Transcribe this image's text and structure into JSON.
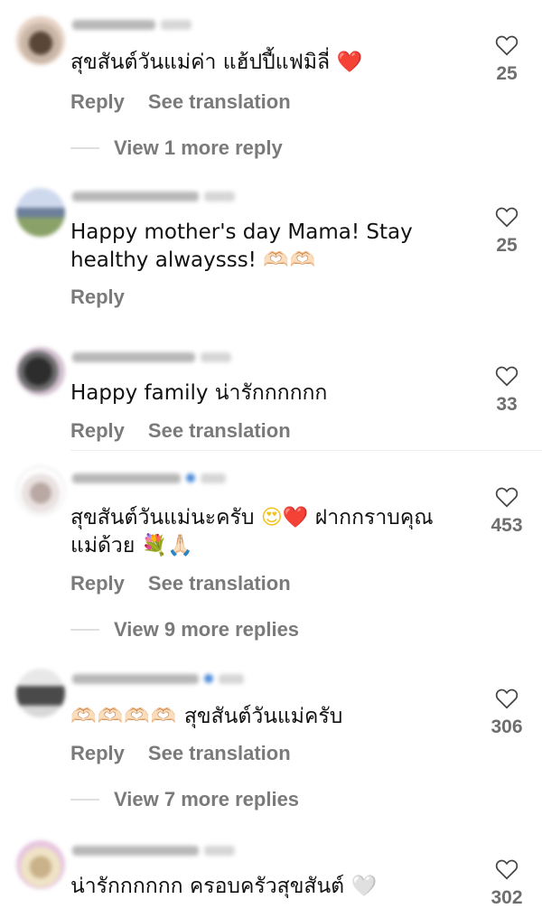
{
  "colors": {
    "action_grey": "#7a7a7a",
    "count_grey": "#6e6e6e",
    "verified_blue": "#4a8ad8",
    "heart_red": "#e3242b"
  },
  "icons": {
    "like": "heart-outline-icon"
  },
  "comments": [
    {
      "text": "สุขสันต์วันแม่ค่า แฮ้ปปี้แฟมิลี่ ",
      "emoji": "❤️",
      "actions": [
        "Reply",
        "See translation"
      ],
      "likes": "25",
      "more": "View 1 more reply"
    },
    {
      "text": "Happy mother's day Mama! Stay healthy alwaysss! ",
      "emoji": "🫶🏻🫶🏻",
      "actions": [
        "Reply"
      ],
      "likes": "25"
    },
    {
      "text": "Happy family น่ารักกกกกก",
      "actions": [
        "Reply",
        "See translation"
      ],
      "likes": "33"
    },
    {
      "text": "สุขสันต์วันแม่นะครับ ",
      "emoji": "😍❤️",
      "text2": " ฝากกราบคุณแม่ด้วย ",
      "emoji2": "💐🙏🏻",
      "actions": [
        "Reply",
        "See translation"
      ],
      "likes": "453",
      "more": "View 9 more replies"
    },
    {
      "emoji": "🫶🏻🫶🏻🫶🏻🫶🏻",
      "text": " สุขสันต์วันแม่ครับ",
      "actions": [
        "Reply",
        "See translation"
      ],
      "likes": "306",
      "more": "View 7 more replies"
    },
    {
      "text": "น่ารักกกกกก ครอบครัวสุขสันต์ ",
      "emoji": "🤍",
      "likes": "302"
    }
  ]
}
